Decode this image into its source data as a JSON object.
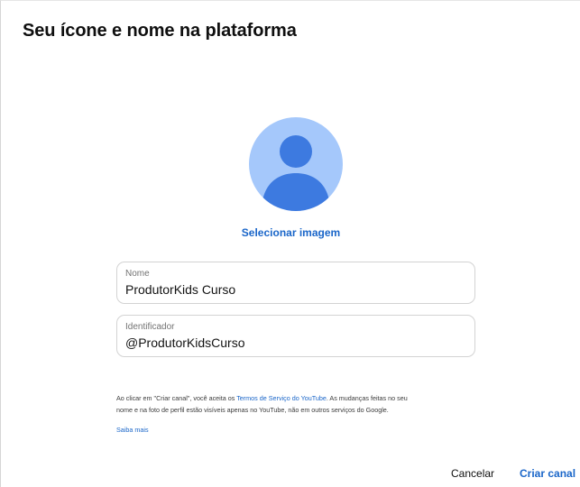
{
  "dialog": {
    "title": "Seu ícone e nome na plataforma",
    "select_image_label": "Selecionar imagem",
    "avatar_icon": "default-person-avatar",
    "name_field": {
      "label": "Nome",
      "value": "ProdutorKids Curso"
    },
    "handle_field": {
      "label": "Identificador",
      "value": "@ProdutorKidsCurso"
    },
    "disclaimer": {
      "text_before_link": "Ao clicar em \"Criar canal\", você aceita os ",
      "terms_link": "Termos de Serviço do YouTube",
      "text_line1_after": ". As mudanças feitas no seu",
      "text_line2": "nome e na foto de perfil estão visíveis apenas no YouTube, não em outros serviços do Google.",
      "learn_more": "Saiba mais"
    },
    "buttons": {
      "cancel": "Cancelar",
      "create": "Criar canal"
    }
  },
  "colors": {
    "accent": "#1a66c9",
    "avatar_bg": "#a5c8fb",
    "avatar_figure": "#3d7ae0"
  }
}
